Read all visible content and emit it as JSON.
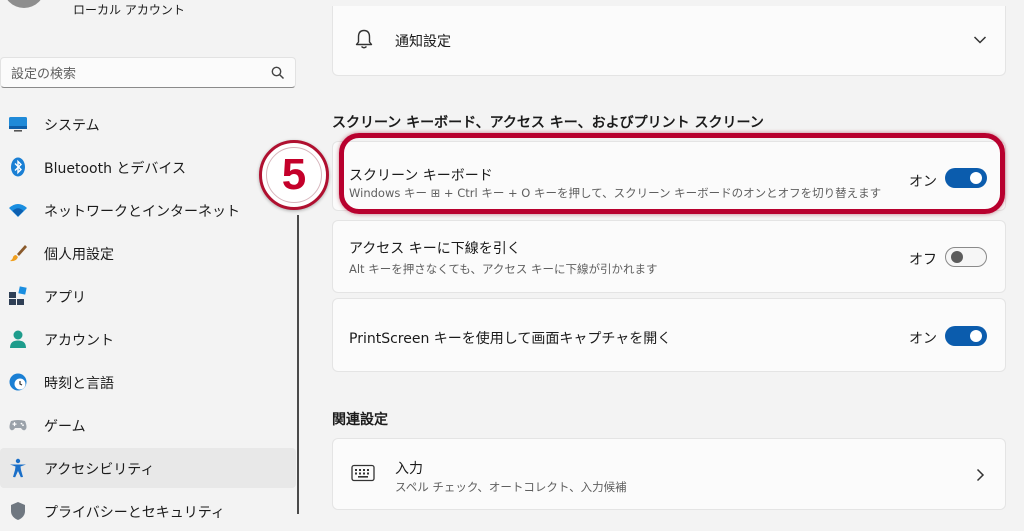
{
  "account": {
    "label": "ローカル アカウント"
  },
  "search": {
    "placeholder": "設定の検索"
  },
  "nav": [
    {
      "label": "システム",
      "icon": "monitor-icon"
    },
    {
      "label": "Bluetooth とデバイス",
      "icon": "bluetooth-icon"
    },
    {
      "label": "ネットワークとインターネット",
      "icon": "wifi-icon"
    },
    {
      "label": "個人用設定",
      "icon": "brush-icon"
    },
    {
      "label": "アプリ",
      "icon": "apps-icon"
    },
    {
      "label": "アカウント",
      "icon": "person-icon"
    },
    {
      "label": "時刻と言語",
      "icon": "clock-globe-icon"
    },
    {
      "label": "ゲーム",
      "icon": "gamepad-icon"
    },
    {
      "label": "アクセシビリティ",
      "icon": "accessibility-icon",
      "active": true
    },
    {
      "label": "プライバシーとセキュリティ",
      "icon": "shield-icon"
    }
  ],
  "annotation": {
    "step": "5"
  },
  "notifications": {
    "label": "通知設定"
  },
  "section1": {
    "heading": "スクリーン キーボード、アクセス キー、およびプリント スクリーン"
  },
  "settings": [
    {
      "title": "スクリーン キーボード",
      "desc": "Windows キー ⊞ + Ctrl キー + O キーを押して、スクリーン キーボードのオンとオフを切り替えます",
      "state": "オン",
      "on": true
    },
    {
      "title": "アクセス キーに下線を引く",
      "desc": "Alt キーを押さなくても、アクセス キーに下線が引かれます",
      "state": "オフ",
      "on": false
    },
    {
      "title": "PrintScreen キーを使用して画面キャプチャを開く",
      "state": "オン",
      "on": true
    }
  ],
  "section2": {
    "heading": "関連設定"
  },
  "related": {
    "title": "入力",
    "desc": "スペル チェック、オートコレクト、入力候補"
  },
  "colors": {
    "accent": "#0b5cad",
    "annotation": "#c4002a",
    "highlight": "#b8002e"
  }
}
